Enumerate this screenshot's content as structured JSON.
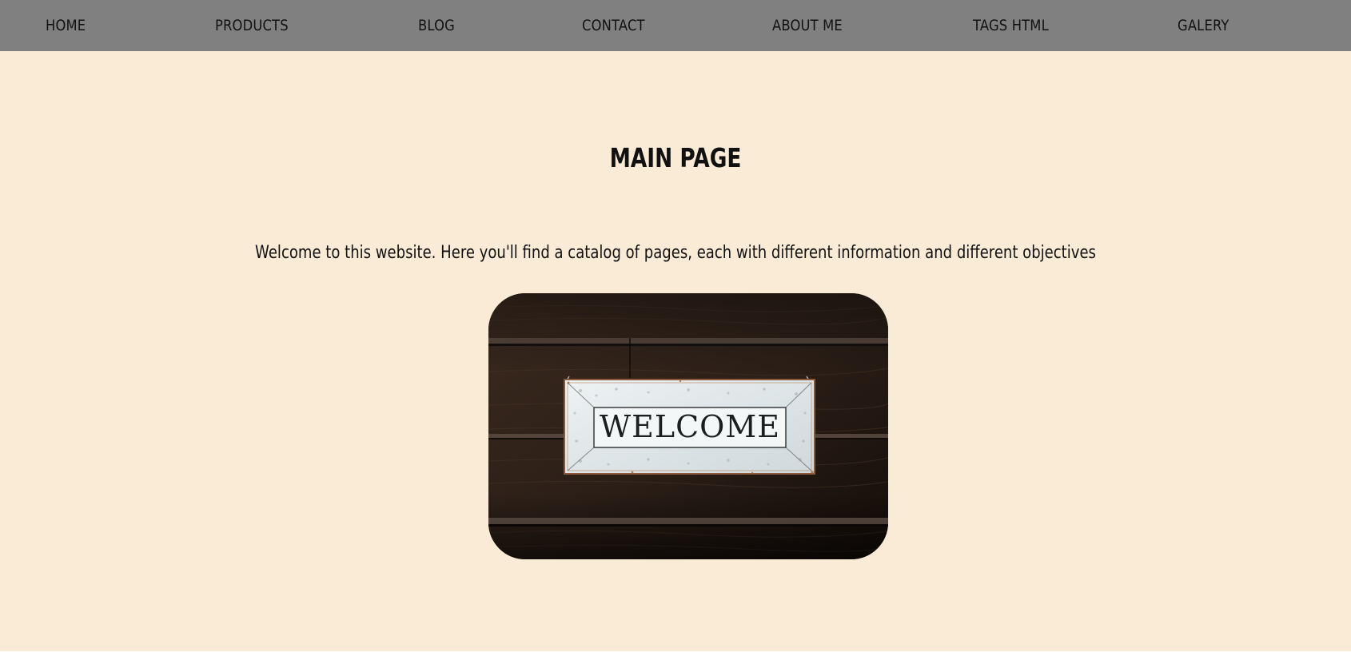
{
  "nav": {
    "items": [
      {
        "label": "HOME"
      },
      {
        "label": "PRODUCTS"
      },
      {
        "label": "BLOG"
      },
      {
        "label": "CONTACT"
      },
      {
        "label": "ABOUT ME"
      },
      {
        "label": "TAGS HTML"
      },
      {
        "label": "GALERY"
      }
    ]
  },
  "main": {
    "title": "MAIN PAGE",
    "intro": "Welcome to this website. Here you'll find a catalog of pages, each with different information and different objectives",
    "image": {
      "sign_text": "WELCOME"
    }
  },
  "colors": {
    "navbar_bg": "#808080",
    "page_bg": "#faebd7",
    "text": "#111111"
  }
}
